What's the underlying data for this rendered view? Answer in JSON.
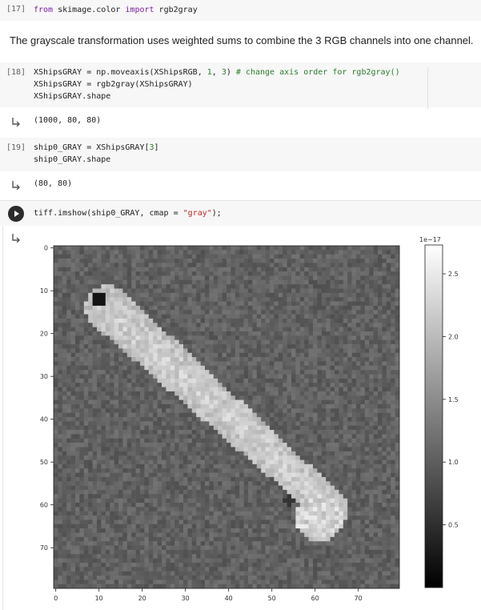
{
  "cells": [
    {
      "exec_count": "[17]",
      "code_lines": [
        [
          {
            "t": "from",
            "c": "kw"
          },
          {
            "t": " skimage.color ",
            "c": ""
          },
          {
            "t": "import",
            "c": "kw"
          },
          {
            "t": " rgb2gray",
            "c": ""
          }
        ]
      ]
    },
    {
      "markdown": "The grayscale transformation uses weighted sums to combine the 3 RGB channels into one channel."
    },
    {
      "exec_count": "[18]",
      "code_lines": [
        [
          {
            "t": "XShipsGRAY = np.moveaxis(XShipsRGB, ",
            "c": ""
          },
          {
            "t": "1",
            "c": "num"
          },
          {
            "t": ", ",
            "c": ""
          },
          {
            "t": "3",
            "c": "num"
          },
          {
            "t": ") ",
            "c": ""
          },
          {
            "t": "# change axis order for rgb2gray()",
            "c": "cmt"
          }
        ],
        [
          {
            "t": "XShipsGRAY = rgb2gray(XShipsGRAY)",
            "c": ""
          }
        ],
        [
          {
            "t": "XShipsGRAY.shape",
            "c": ""
          }
        ]
      ],
      "output": "(1000, 80, 80)"
    },
    {
      "exec_count": "[19]",
      "code_lines": [
        [
          {
            "t": "ship0_GRAY = XShipsGRAY[",
            "c": ""
          },
          {
            "t": "3",
            "c": "num"
          },
          {
            "t": "]",
            "c": ""
          }
        ],
        [
          {
            "t": "ship0_GRAY.shape",
            "c": ""
          }
        ]
      ],
      "output": "(80, 80)"
    },
    {
      "exec_count": "",
      "code_lines": [
        [
          {
            "t": "tiff.imshow(ship0_GRAY, cmap = ",
            "c": ""
          },
          {
            "t": "\"gray\"",
            "c": "str"
          },
          {
            "t": ");",
            "c": ""
          }
        ]
      ]
    }
  ],
  "icons": {
    "output": "output-arrow-icon",
    "run": "play-icon"
  },
  "figure": {
    "x_ticks": [
      "0",
      "10",
      "20",
      "30",
      "40",
      "50",
      "60",
      "70"
    ],
    "y_ticks": [
      "0",
      "10",
      "20",
      "30",
      "40",
      "50",
      "60",
      "70"
    ],
    "colorbar_ticks": [
      "2.5",
      "2.0",
      "1.5",
      "1.0",
      "0.5"
    ],
    "colorbar_exponent": "1e−17",
    "image_size": [
      80,
      80
    ]
  }
}
